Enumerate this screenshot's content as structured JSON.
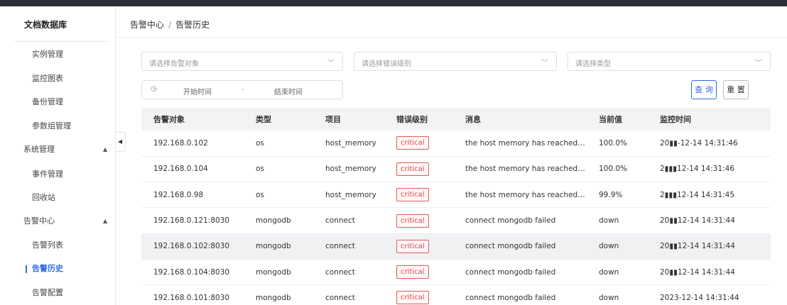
{
  "sidebar": {
    "brand": "文档数据库",
    "items": [
      {
        "label": "实例管理",
        "kind": "sub",
        "name": "sidebar-item-instance"
      },
      {
        "label": "监控图表",
        "kind": "sub",
        "name": "sidebar-item-monitor-charts"
      },
      {
        "label": "备份管理",
        "kind": "sub",
        "name": "sidebar-item-backup"
      },
      {
        "label": "参数组管理",
        "kind": "sub",
        "name": "sidebar-item-param-groups"
      },
      {
        "label": "系统管理",
        "kind": "group",
        "caret": "▲",
        "name": "sidebar-group-system"
      },
      {
        "label": "事件管理",
        "kind": "sub",
        "name": "sidebar-item-events"
      },
      {
        "label": "回收站",
        "kind": "sub",
        "name": "sidebar-item-recycle-bin"
      },
      {
        "label": "告警中心",
        "kind": "group",
        "caret": "▲",
        "name": "sidebar-group-alerts"
      },
      {
        "label": "告警列表",
        "kind": "sub",
        "name": "sidebar-item-alert-list"
      },
      {
        "label": "告警历史",
        "kind": "sub",
        "active": true,
        "name": "sidebar-item-alert-history"
      },
      {
        "label": "告警配置",
        "kind": "sub",
        "name": "sidebar-item-alert-config"
      }
    ],
    "collapse_icon": "◀"
  },
  "breadcrumb": {
    "parent": "告警中心",
    "separator": "/",
    "current": "告警历史"
  },
  "filters": {
    "target_placeholder": "请选择告警对象",
    "level_placeholder": "请选择错误级别",
    "type_placeholder": "请选择类型",
    "chevron": "﹀",
    "start_placeholder": "开始时间",
    "range_dash": "-",
    "end_placeholder": "结束时间",
    "clock_icon": "◷"
  },
  "buttons": {
    "query": "查 询",
    "reset": "重 置"
  },
  "colors": {
    "accent": "#2e6be6",
    "critical": "#e04848"
  },
  "table": {
    "columns": [
      "告警对象",
      "类型",
      "项目",
      "错误级别",
      "消息",
      "当前值",
      "监控时间"
    ],
    "rows": [
      {
        "target": "192.168.0.102",
        "type": "os",
        "item": "host_memory",
        "level": "critical",
        "message": "the host memory has reached the cri...",
        "value": "100.0%",
        "time": "20▮▮-12-14 14:31:46"
      },
      {
        "target": "192.168.0.104",
        "type": "os",
        "item": "host_memory",
        "level": "critical",
        "message": "the host memory has reached the cri...",
        "value": "100.0%",
        "time": "2▮▮▮12-14 14:31:46"
      },
      {
        "target": "192.168.0.98",
        "type": "os",
        "item": "host_memory",
        "level": "critical",
        "message": "the host memory has reached the cri...",
        "value": "99.9%",
        "time": "2▮▮▮12-14 14:31:45"
      },
      {
        "target": "192.168.0.121:8030",
        "type": "mongodb",
        "item": "connect",
        "level": "critical",
        "message": "connect mongodb failed",
        "value": "down",
        "time": "20▮▮12-14 14:31:44"
      },
      {
        "target": "192.168.0.102:8030",
        "type": "mongodb",
        "item": "connect",
        "level": "critical",
        "message": "connect mongodb failed",
        "value": "down",
        "time": "20▮▮12-14 14:31:44"
      },
      {
        "target": "192.168.0.104:8030",
        "type": "mongodb",
        "item": "connect",
        "level": "critical",
        "message": "connect mongodb failed",
        "value": "down",
        "time": "20▮▮12-14 14:31:44"
      },
      {
        "target": "192.168.0.101:8030",
        "type": "mongodb",
        "item": "connect",
        "level": "critical",
        "message": "connect mongodb failed",
        "value": "down",
        "time": "2023-12-14 14:31:44"
      }
    ]
  }
}
